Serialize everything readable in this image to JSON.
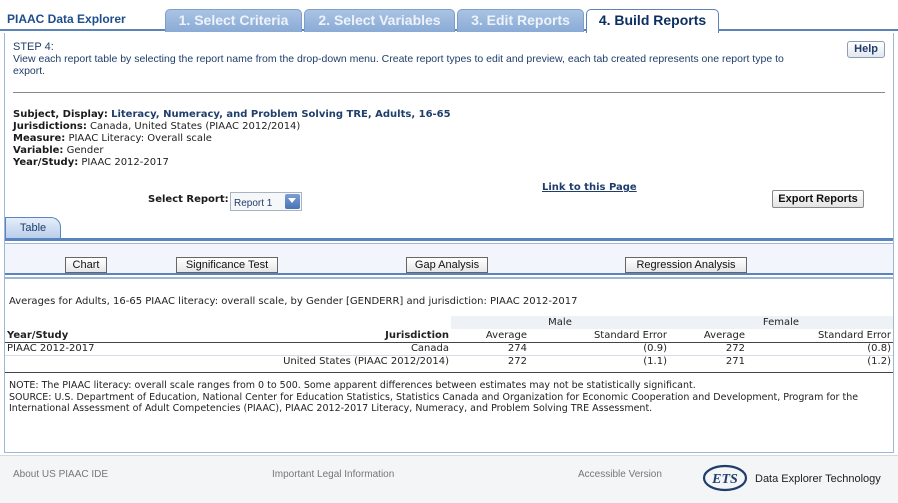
{
  "app": {
    "title": "PIAAC Data Explorer"
  },
  "tabs": [
    {
      "label": "1. Select Criteria"
    },
    {
      "label": "2. Select Variables"
    },
    {
      "label": "3. Edit Reports"
    },
    {
      "label": "4. Build Reports"
    }
  ],
  "step": {
    "title": "STEP 4:",
    "description": "View each report table by selecting the report name from the drop-down menu. Create report types to edit and preview, each tab created represents one report type to export.",
    "help_label": "Help"
  },
  "meta": {
    "subject_label": "Subject, Display:",
    "subject_value": "Literacy, Numeracy, and Problem Solving TRE, Adults, 16-65",
    "jurisdictions_label": "Jurisdictions:",
    "jurisdictions_value": "Canada, United States (PIAAC 2012/2014)",
    "measure_label": "Measure:",
    "measure_value": "PIAAC Literacy: Overall scale",
    "variable_label": "Variable:",
    "variable_value": "Gender",
    "year_label": "Year/Study:",
    "year_value": "PIAAC 2012-2017"
  },
  "controls": {
    "link_label": "Link to this Page",
    "select_label": "Select Report:",
    "select_value": "Report 1",
    "export_label": "Export Reports"
  },
  "subtab": {
    "label": "Table"
  },
  "toolbar": {
    "chart": "Chart",
    "significance": "Significance Test",
    "gap": "Gap Analysis",
    "regression": "Regression Analysis"
  },
  "report": {
    "title": "Averages for Adults, 16-65 PIAAC literacy: overall scale, by Gender [GENDERR] and jurisdiction: PIAAC 2012-2017",
    "group_male": "Male",
    "group_female": "Female",
    "col_year": "Year/Study",
    "col_jurisdiction": "Jurisdiction",
    "col_average": "Average",
    "col_se": "Standard Error",
    "rows": [
      {
        "year": "PIAAC 2012-2017",
        "jurisdiction": "Canada",
        "male_avg": "274",
        "male_se": "(0.9)",
        "female_avg": "272",
        "female_se": "(0.8)"
      },
      {
        "year": "",
        "jurisdiction": "United States (PIAAC 2012/2014)",
        "male_avg": "272",
        "male_se": "(1.1)",
        "female_avg": "271",
        "female_se": "(1.2)"
      }
    ],
    "note": "NOTE: The PIAAC literacy: overall scale ranges from 0 to 500. Some apparent differences between estimates may not be statistically significant.",
    "source": "SOURCE: U.S. Department of Education, National Center for Education Statistics, Statistics Canada and Organization for Economic Cooperation and Development, Program for the International Assessment of Adult Competencies (PIAAC), PIAAC 2012-2017 Literacy, Numeracy, and Problem Solving TRE Assessment."
  },
  "footer": {
    "about": "About US PIAAC IDE",
    "legal": "Important Legal Information",
    "accessible": "Accessible Version",
    "logo_text": "ETS",
    "tagline": "Data Explorer Technology"
  },
  "colors": {
    "accent": "#5b83b5",
    "tab_inactive": "#8aabd6",
    "title_blue": "#1f4e8c"
  }
}
